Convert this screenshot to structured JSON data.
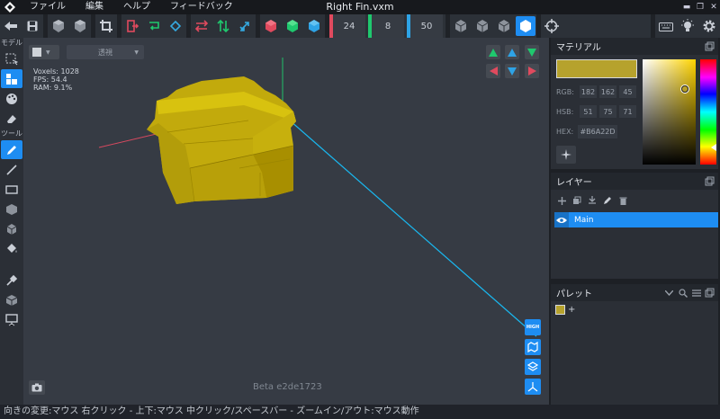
{
  "app": {
    "title": "Right Fin.vxm"
  },
  "menu": [
    "ファイル",
    "編集",
    "ヘルプ",
    "フィードバック"
  ],
  "toolbar": {
    "brush_x": "24",
    "brush_y": "8",
    "brush_z": "50"
  },
  "left": {
    "section_model": "モデル",
    "section_tool": "ツール"
  },
  "viewport": {
    "view_mode": "透視",
    "stats": {
      "voxels": "Voxels: 1028",
      "fps": "FPS: 54.4",
      "ram": "RAM: 9.1%"
    },
    "version": "Beta e2de1723",
    "render_quality": "HIGH"
  },
  "material": {
    "title": "マテリアル",
    "color": "#B6A22D",
    "rgb_label": "RGB:",
    "rgb": [
      "182",
      "162",
      "45"
    ],
    "hsb_label": "HSB:",
    "hsb": [
      "51",
      "75",
      "71"
    ],
    "hex_label": "HEX:",
    "hex": "#B6A22D"
  },
  "layers": {
    "title": "レイヤー",
    "items": [
      {
        "name": "Main",
        "visible": true,
        "selected": true
      }
    ]
  },
  "palette": {
    "title": "パレット",
    "add": "+",
    "colors": [
      "#B6A22D"
    ]
  },
  "status": {
    "text": "向きの変更:マウス 右クリック - 上下:マウス 中クリック/スペースバー - ズームイン/アウト:マウス動作"
  }
}
